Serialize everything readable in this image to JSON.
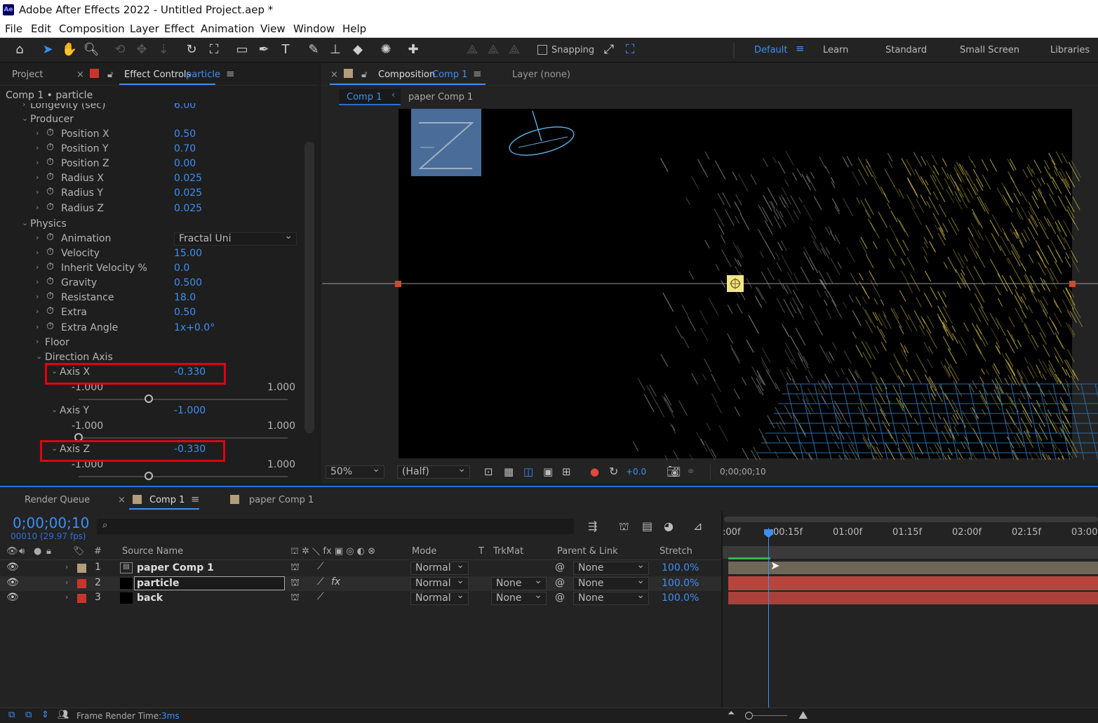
{
  "window": {
    "title": "Adobe After Effects 2022 - Untitled Project.aep *",
    "logo": "Ae"
  },
  "menu": [
    "File",
    "Edit",
    "Composition",
    "Layer",
    "Effect",
    "Animation",
    "View",
    "Window",
    "Help"
  ],
  "toolbar": {
    "snapping_label": "Snapping"
  },
  "workspaces": [
    "Default",
    "Learn",
    "Standard",
    "Small Screen",
    "Libraries"
  ],
  "left_panel": {
    "tab_project": "Project",
    "tab_effect_controls": "Effect Controls",
    "tab_effect_target": "particle",
    "breadcrumb": "Comp 1 • particle",
    "rows": {
      "longevity": {
        "label": "Longevity (sec)",
        "value": "6.00"
      },
      "producer": {
        "label": "Producer"
      },
      "pos_x": {
        "label": "Position X",
        "value": "0.50"
      },
      "pos_y": {
        "label": "Position Y",
        "value": "0.70"
      },
      "pos_z": {
        "label": "Position Z",
        "value": "0.00"
      },
      "rad_x": {
        "label": "Radius X",
        "value": "0.025"
      },
      "rad_y": {
        "label": "Radius Y",
        "value": "0.025"
      },
      "rad_z": {
        "label": "Radius Z",
        "value": "0.025"
      },
      "physics": {
        "label": "Physics"
      },
      "animation": {
        "label": "Animation",
        "value": "Fractal Uni"
      },
      "velocity": {
        "label": "Velocity",
        "value": "15.00"
      },
      "inherit": {
        "label": "Inherit Velocity %",
        "value": "0.0"
      },
      "gravity": {
        "label": "Gravity",
        "value": "0.500"
      },
      "resistance": {
        "label": "Resistance",
        "value": "18.0"
      },
      "extra": {
        "label": "Extra",
        "value": "0.50"
      },
      "extra_angle": {
        "label": "Extra Angle",
        "value": "1x+0.0°"
      },
      "floor": {
        "label": "Floor"
      },
      "direction_axis": {
        "label": "Direction Axis"
      },
      "axis_x": {
        "label": "Axis X",
        "value": "-0.330",
        "min": "-1.000",
        "max": "1.000",
        "level": -0.33
      },
      "axis_y": {
        "label": "Axis Y",
        "value": "-1.000",
        "min": "-1.000",
        "max": "1.000",
        "level": -1.0
      },
      "axis_z": {
        "label": "Axis Z",
        "value": "-0.330",
        "min": "-1.000",
        "max": "1.000",
        "level": -0.33
      }
    }
  },
  "viewer": {
    "tab_composition": "Composition",
    "tab_comp_name": "Comp 1",
    "tab_layer": "Layer (none)",
    "crumbs": [
      "Comp 1",
      "paper Comp 1"
    ],
    "zoom": "50%",
    "resolution": "(Half)",
    "exposure": "+0.0",
    "timecode": "0;00;00;10"
  },
  "timeline": {
    "tab_render_queue": "Render Queue",
    "tab_comp": "Comp 1",
    "tab_paper": "paper Comp 1",
    "current_time": "0;00;00;10",
    "frame_info": "00010 (29.97 fps)",
    "columns": {
      "num": "#",
      "source": "Source Name",
      "mode": "Mode",
      "t": "T",
      "trkmat": "TrkMat",
      "parent": "Parent & Link",
      "stretch": "Stretch"
    },
    "ruler": [
      ":00f",
      "00:15f",
      "01:00f",
      "01:15f",
      "02:00f",
      "02:15f",
      "03:00"
    ],
    "layers": [
      {
        "num": "1",
        "name": "paper Comp 1",
        "mode": "Normal",
        "trkmat": "",
        "parent": "None",
        "stretch": "100.0%",
        "color": "#b39d7a"
      },
      {
        "num": "2",
        "name": "particle",
        "mode": "Normal",
        "trkmat": "None",
        "parent": "None",
        "stretch": "100.0%",
        "color": "#c9352b"
      },
      {
        "num": "3",
        "name": "back",
        "mode": "Normal",
        "trkmat": "None",
        "parent": "None",
        "stretch": "100.0%",
        "color": "#c9352b"
      }
    ],
    "render_time_label": "Frame Render Time:",
    "render_time_value": "3ms"
  }
}
